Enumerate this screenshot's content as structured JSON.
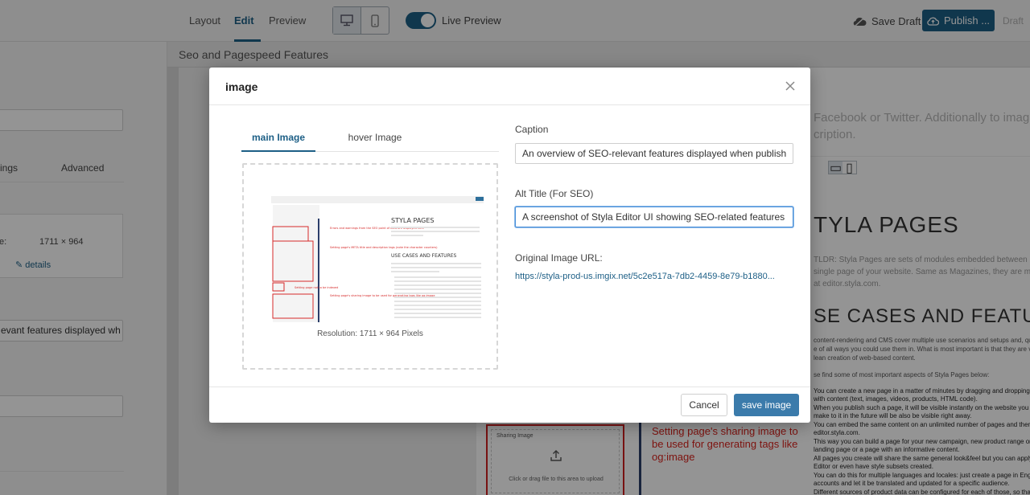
{
  "toolbar": {
    "tabs": [
      {
        "label": "Layout"
      },
      {
        "label": "Edit"
      },
      {
        "label": "Preview"
      }
    ],
    "live_preview_label": "Live Preview",
    "save_draft_label": "Save Draft",
    "publish_label": "Publish ...",
    "status_label": "Draft",
    "accent_color": "#1d5f86"
  },
  "left_panel": {
    "tab_partial": "ings",
    "tab_advanced": "Advanced",
    "size_label_partial": "e:",
    "size_value": "1711 × 964",
    "details_label": "details",
    "caption_partial": "evant features displayed wh"
  },
  "section_title": "Seo and Pagespeed Features",
  "preview": {
    "intro_line1": "Facebook or Twitter. Additionally to imag",
    "intro_line2": "cription.",
    "heading1": "TYLA PAGES",
    "tldr1": "TLDR: Styla Pages are sets of modules embedded between he",
    "tldr2": "single page of your website. Same as Magazines, they are mai",
    "tldr3": "at editor.styla.com.",
    "heading2": "SE CASES AND FEATURES",
    "p1": "content-rendering and CMS cover multiple use scenarios and setups and, quite",
    "p2": "e of all ways you could use them in. What is most important is that they are very",
    "p3": "lean creation of web-based content.",
    "p4": "se find some of most important aspects of Styla Pages below:",
    "b1": "You can create a new page in a matter of minutes by dragging and dropping m",
    "b1b": "with content (text, images, videos, products, HTML code).",
    "b2": "When you publish such a page, it will be visible instantly on the website you en",
    "b2b": "make to it in the future will be also be visible right away.",
    "b3": "You can embed the same content on an unlimited number of pages and then e",
    "b3b": "editor.styla.com.",
    "b4": "This way you can build a page for your new campaign, new product range or a",
    "b4b": "landing page or a page with an informative content.",
    "b5": "All pages you create will share the same general look&feel but you can apply c",
    "b5b": "Editor or even have style subsets created.",
    "b6": "You can do this for multiple languages and locales: just create a page in Englis",
    "b6b": "accounts and let it be translated and updated for a specific audience.",
    "b7": "Different sources of product data can be configured for each of those, so that",
    "sharing_title": "Sharing Image",
    "sharing_hint": "Click or drag file to this area to upload",
    "sharing_note": "Setting page's sharing image to be used for generating tags like og:image"
  },
  "modal": {
    "title": "image",
    "tabs": [
      {
        "label": "main Image"
      },
      {
        "label": "hover Image"
      }
    ],
    "resolution": "Resolution: 1711 × 964 Pixels",
    "caption_label": "Caption",
    "caption_value": "An overview of SEO-relevant features displayed when publish",
    "alt_label": "Alt Title (For SEO)",
    "alt_value": "A screenshot of Styla Editor UI showing SEO-related features",
    "url_label": "Original Image URL:",
    "url_value": "https://styla-prod-us.imgix.net/5c2e517a-7db2-4459-8e79-b1880...",
    "cancel_label": "Cancel",
    "save_label": "save image"
  },
  "thumbnail": {
    "title": "STYLA PAGES",
    "subtitle": "USE CASES AND FEATURES",
    "annot1": "Errors and warnings from the SEO point of view are displayed here",
    "annot2": "Setting page's META title and description tags (note the character counters)",
    "annot3": "Setting page not to be indexed",
    "annot4": "Setting page's sharing image to be used for generating tags like og:image"
  }
}
